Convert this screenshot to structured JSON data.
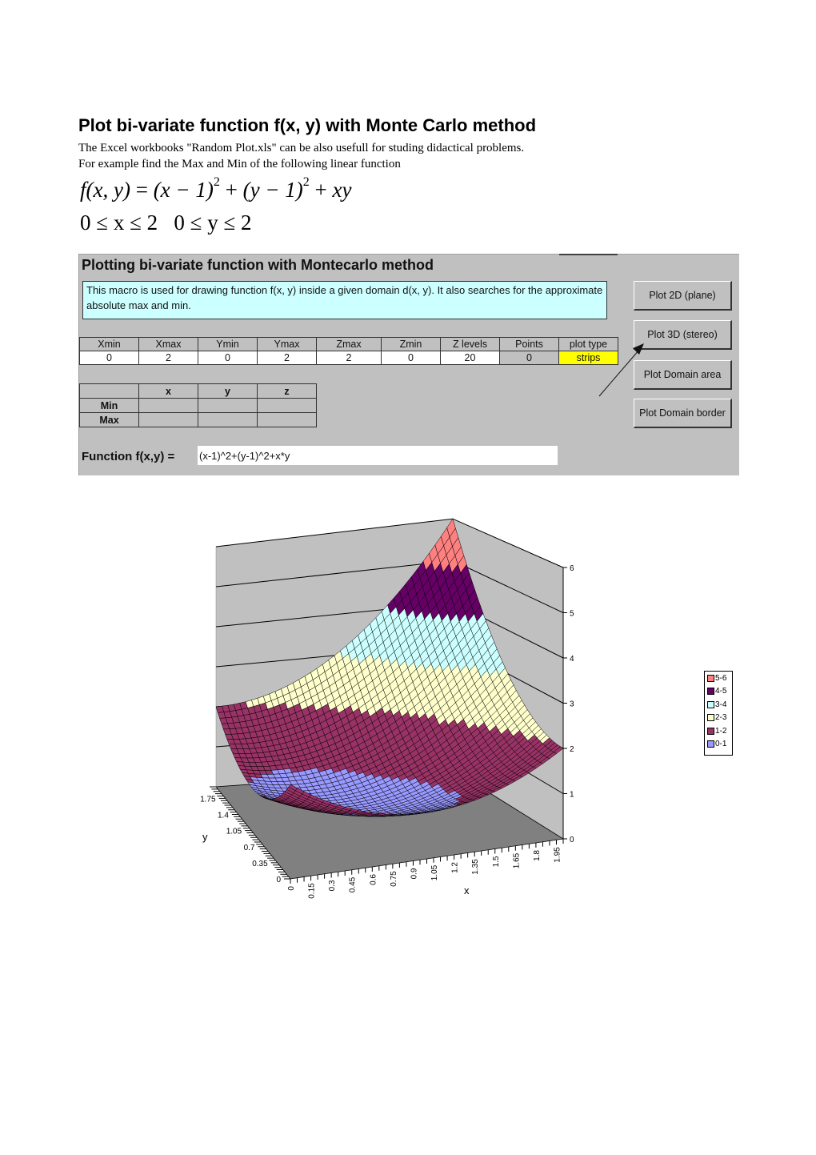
{
  "document": {
    "title": "Plot bi-variate function f(x, y) with Monte Carlo method",
    "paragraph_line1": "The Excel workbooks \"Random Plot.xls\" can be also usefull for studing didactical problems.",
    "paragraph_line2": "For example find the Max and Min of the following linear function",
    "equation": {
      "lhs": "f(x, y)",
      "rhs_term1": "(x − 1)",
      "rhs_term2": "(y − 1)",
      "rhs_term3": "xy",
      "exponent": "2"
    },
    "constraint": {
      "x_range": "0 ≤ x ≤ 2",
      "y_range": "0 ≤ y ≤ 2"
    }
  },
  "panel": {
    "title": "Plotting bi-variate function with Montecarlo method",
    "description": "This macro is used for drawing function f(x, y) inside a given domain d(x, y).  It also searches for the approximate absolute max and min.",
    "params": {
      "headers": [
        "Xmin",
        "Xmax",
        "Ymin",
        "Ymax",
        "Zmax",
        "Zmin",
        "Z levels",
        "Points",
        "plot type"
      ],
      "values": [
        "0",
        "2",
        "0",
        "2",
        "2",
        "0",
        "20",
        "0",
        "strips"
      ]
    },
    "minmax": {
      "headers": [
        "",
        "x",
        "y",
        "z"
      ],
      "rows": [
        {
          "label": "Min",
          "x": "",
          "y": "",
          "z": ""
        },
        {
          "label": "Max",
          "x": "",
          "y": "",
          "z": ""
        }
      ]
    },
    "function_label": "Function f(x,y) =",
    "function_value": "(x-1)^2+(y-1)^2+x*y",
    "buttons": {
      "plot2d": "Plot 2D (plane)",
      "plot3d": "Plot 3D (stereo)",
      "domain_area": "Plot Domain area",
      "domain_border": "Plot Domain border"
    },
    "colors": {
      "background": "#c0c0c0",
      "description_bg": "#ccffff",
      "highlight": "#ffff00"
    }
  },
  "chart_data": {
    "type": "surface3d",
    "function": "(x-1)^2+(y-1)^2+x*y",
    "title": "",
    "xlabel": "x",
    "ylabel": "y",
    "zlabel": "",
    "x_ticks": [
      "0",
      "0.15",
      "0.3",
      "0.45",
      "0.6",
      "0.75",
      "0.9",
      "1.05",
      "1.2",
      "1.35",
      "1.5",
      "1.65",
      "1.8",
      "1.95"
    ],
    "y_ticks": [
      "0",
      "0.35",
      "0.7",
      "1.05",
      "1.4",
      "1.75"
    ],
    "z_ticks": [
      "0",
      "1",
      "2",
      "3",
      "4",
      "5",
      "6"
    ],
    "xlim": [
      0,
      2
    ],
    "ylim": [
      0,
      2
    ],
    "zlim": [
      0,
      6
    ],
    "grid_step": 0.05,
    "legend_position": "right",
    "legend": [
      {
        "label": "5-6",
        "color": "#ff8080"
      },
      {
        "label": "4-5",
        "color": "#660066"
      },
      {
        "label": "3-4",
        "color": "#ccffff"
      },
      {
        "label": "2-3",
        "color": "#ffffcc"
      },
      {
        "label": "1-2",
        "color": "#993366"
      },
      {
        "label": "0-1",
        "color": "#9999ff"
      }
    ],
    "bands": [
      {
        "range": [
          0,
          1
        ],
        "color": "#9999ff"
      },
      {
        "range": [
          1,
          2
        ],
        "color": "#993366"
      },
      {
        "range": [
          2,
          3
        ],
        "color": "#ffffcc"
      },
      {
        "range": [
          3,
          4
        ],
        "color": "#ccffff"
      },
      {
        "range": [
          4,
          5
        ],
        "color": "#660066"
      },
      {
        "range": [
          5,
          6
        ],
        "color": "#ff8080"
      }
    ],
    "wall_color": "#c0c0c0",
    "floor_color": "#808080"
  }
}
